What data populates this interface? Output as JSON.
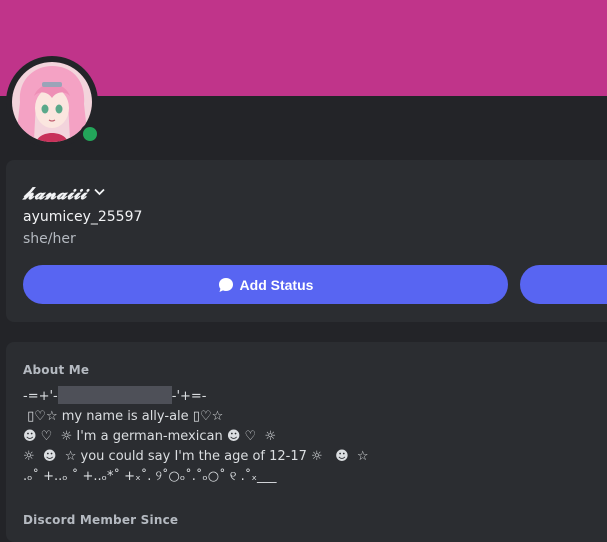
{
  "profile": {
    "display_name": "𝓱𝓪𝓷𝓪𝓲𝓲𝓲",
    "username": "ayumicey_25597",
    "pronouns": "she/her",
    "status": "online"
  },
  "actions": {
    "add_status_label": "Add Status"
  },
  "about": {
    "title": "About Me",
    "line1_left": "-=+'-",
    "line1_right": "-'+=-",
    "line2": " ▯♡☆ my name is ally-ale ▯♡☆",
    "line3": "☻ ♡  ☼ I'm a german-mexican ☻ ♡  ☼",
    "line4": "☼  ☻  ☆ you could say I'm the age of 12-17 ☼   ☻  ☆",
    "line5": ".ₒ˚ +..ₒ ˚ +..ₒ*˚ +ₓ˚. ୨˚○ₒ˚.˚ₒ○˚ ୧ .˚ₓ___"
  },
  "member": {
    "title": "Discord Member Since"
  },
  "colors": {
    "banner": "#c0348a",
    "accent": "#5865f2",
    "online": "#23a55a"
  }
}
